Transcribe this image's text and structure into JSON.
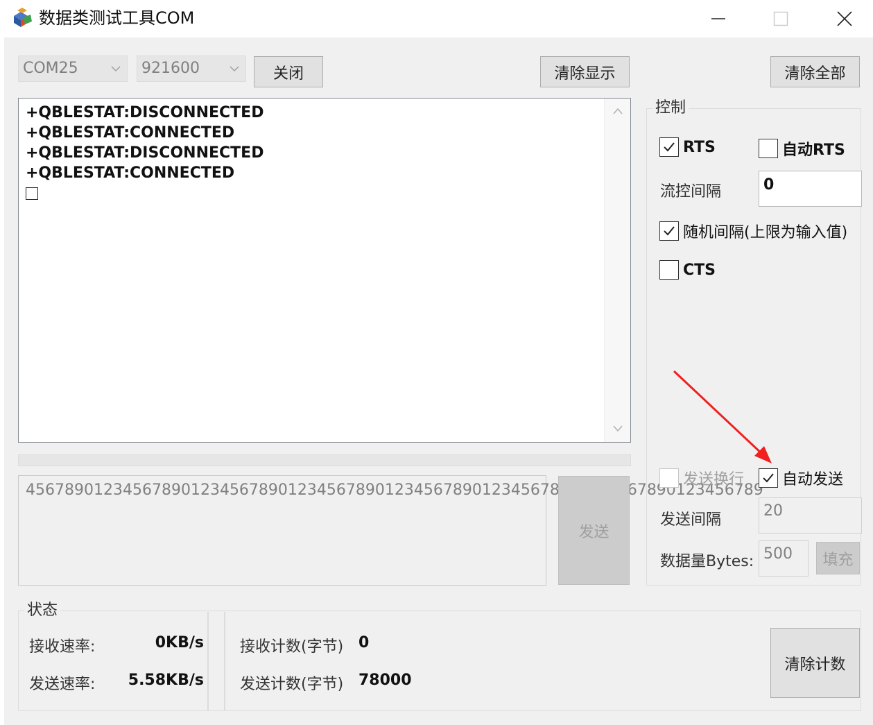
{
  "window": {
    "title": "数据类测试工具COM",
    "min_icon": "minimize-icon",
    "max_icon": "maximize-icon",
    "close_icon": "close-icon"
  },
  "toolbar": {
    "port_value": "COM25",
    "baud_value": "921600",
    "close_label": "关闭",
    "clear_display_label": "清除显示",
    "clear_all_label": "清除全部"
  },
  "receive": {
    "lines": [
      "+QBLESTAT:DISCONNECTED",
      "+QBLESTAT:CONNECTED",
      "+QBLESTAT:DISCONNECTED",
      "+QBLESTAT:CONNECTED"
    ]
  },
  "send": {
    "text": "4567890123456789012345678901234567890123456789012345678901234567890123456789",
    "button_label": "发送"
  },
  "control": {
    "title": "控制",
    "rts_label": "RTS",
    "rts_checked": true,
    "auto_rts_label": "自动RTS",
    "auto_rts_checked": false,
    "flow_interval_label": "流控间隔",
    "flow_interval_value": "0",
    "random_interval_label": "随机间隔(上限为输入值)",
    "random_interval_checked": true,
    "cts_label": "CTS",
    "cts_checked": false,
    "send_newline_label": "发送换行",
    "send_newline_checked": false,
    "auto_send_label": "自动发送",
    "auto_send_checked": true,
    "send_interval_label": "发送间隔",
    "send_interval_value": "20",
    "data_bytes_label": "数据量Bytes:",
    "data_bytes_value": "500",
    "fill_label": "填充"
  },
  "status": {
    "title": "状态",
    "recv_rate_label": "接收速率:",
    "recv_rate_value": "0KB/s",
    "send_rate_label": "发送速率:",
    "send_rate_value": "5.58KB/s",
    "recv_count_label": "接收计数(字节)",
    "recv_count_value": "0",
    "send_count_label": "发送计数(字节)",
    "send_count_value": "78000",
    "clear_count_label": "清除计数"
  },
  "colors": {
    "client_bg": "#f0f0f0",
    "annotation_arrow": "#f02020"
  }
}
